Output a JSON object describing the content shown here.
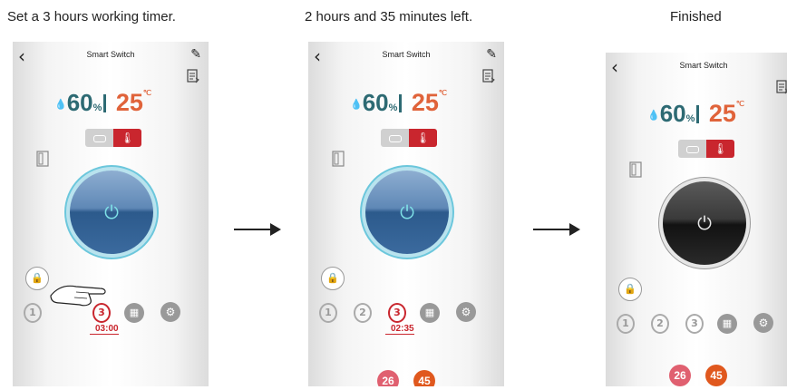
{
  "captions": {
    "step1": "Set a 3 hours working timer.",
    "step2": "2 hours and 35 minutes left.",
    "step3": "Finished"
  },
  "app": {
    "title": "Smart Switch",
    "back_icon": "chevron-left-icon",
    "edit_icon": "pencil-icon",
    "humidity": "60",
    "humidity_unit": "%",
    "temperature": "25",
    "temperature_unit": "℃",
    "colors": {
      "humidity": "#2d6a73",
      "temperature": "#e0633a",
      "heating_mode": "#c9262e",
      "power_on": "#2c5a8c",
      "power_off": "#121212"
    }
  },
  "timers": {
    "t1": "1",
    "t2": "2",
    "t3": "3"
  },
  "screens": [
    {
      "state": "setting",
      "countdown": "03:00",
      "power": "on"
    },
    {
      "state": "running",
      "countdown": "02:35",
      "power": "on",
      "badge_a": "26",
      "badge_b": "45"
    },
    {
      "state": "finished",
      "power": "off",
      "badge_a": "26",
      "badge_b": "45"
    }
  ]
}
